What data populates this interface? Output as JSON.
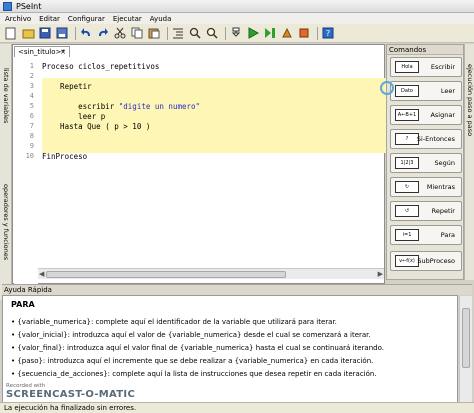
{
  "window": {
    "title": "PSeInt"
  },
  "menu": [
    "Archivo",
    "Editar",
    "Configurar",
    "Ejecutar",
    "Ayuda"
  ],
  "toolbar": {
    "icons": [
      "new-file-icon",
      "open-icon",
      "save-icon",
      "save-as-icon",
      "undo-icon",
      "redo-icon",
      "cut-icon",
      "copy-icon",
      "paste-icon",
      "indent-icon",
      "find-icon",
      "run-icon",
      "step-icon",
      "debug-icon",
      "flowchart-icon",
      "help-icon"
    ]
  },
  "left_tabs": {
    "variables": "lista de variables",
    "operators": "operadores y funciones"
  },
  "editor": {
    "tab_label": "<sin_titulo>*",
    "tab_close": "×",
    "lines": [
      {
        "num": "1",
        "text": "Proceso ciclos_repetitivos"
      },
      {
        "num": "2",
        "text": ""
      },
      {
        "num": "3",
        "text": "    Repetir"
      },
      {
        "num": "4",
        "text": ""
      },
      {
        "num": "5",
        "text": "        escribir ",
        "str": "\"digite un numero\""
      },
      {
        "num": "6",
        "text": "        leer p"
      },
      {
        "num": "7",
        "text": "    Hasta Que ( p > 10 )"
      },
      {
        "num": "8",
        "text": ""
      },
      {
        "num": "9",
        "text": ""
      },
      {
        "num": "10",
        "text": "FinProceso"
      }
    ]
  },
  "commands": {
    "header": "Comandos",
    "items": [
      {
        "label": "Escribir",
        "icon_text": "Hola"
      },
      {
        "label": "Leer",
        "icon_text": "Dato"
      },
      {
        "label": "Asignar",
        "icon_text": "A←B+1"
      },
      {
        "label": "Si-Entonces",
        "icon_text": "?"
      },
      {
        "label": "Según",
        "icon_text": "1|2|3"
      },
      {
        "label": "Mientras",
        "icon_text": "↻"
      },
      {
        "label": "Repetir",
        "icon_text": "↺"
      },
      {
        "label": "Para",
        "icon_text": "i=1"
      },
      {
        "label": "SubProceso",
        "icon_text": "v←f(x)"
      }
    ]
  },
  "right_tab": "ejecución paso a paso",
  "help": {
    "header": "Ayuda Rápida",
    "title": "PARA",
    "lines": [
      "• {variable_numerica}: complete aquí el identificador de la variable que utilizará para iterar.",
      "• {valor_inicial}: introduzca aquí el valor de {variable_numerica} desde el cual se comenzará a iterar.",
      "• {valor_final}: introduzca aquí el valor final de {variable_numerica} hasta el cual se continuará iterando.",
      "• {paso}: introduzca aquí el incremente que se debe realizar a {variable_numerica} en cada iteración.",
      "• {secuencia_de_acciones}: complete aquí la lista de instrucciones que desea repetir en cada iteración."
    ]
  },
  "status": "La ejecución ha finalizado sin errores.",
  "watermark": {
    "line1": "Recorded with",
    "line2": "SCREENCAST-O-MATIC"
  }
}
